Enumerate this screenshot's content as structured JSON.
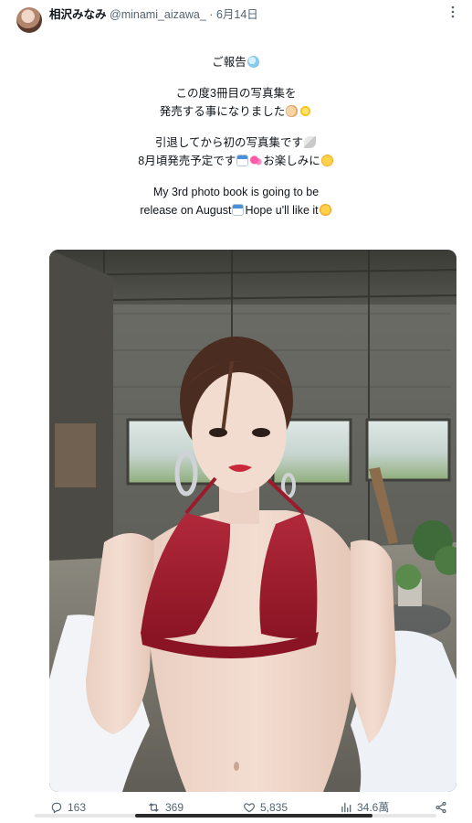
{
  "tweet": {
    "author_name": "相沢みなみ",
    "handle": "@minami_aizawa_",
    "separator": "·",
    "date": "6月14日",
    "lines": {
      "l1": "ご報告",
      "l2": "この度3冊目の写真集を",
      "l3": "発売する事になりました",
      "l4": "引退してから初の写真集です",
      "l5a": "8月頃発売予定です",
      "l5b": "お楽しみに",
      "l6": "My 3rd photo book is going to be",
      "l7a": "release on August",
      "l7b": "Hope u'll like it"
    },
    "emoji_icons": [
      "bubbles-emoji",
      "clapping-hands-emoji",
      "sparkle-emoji",
      "wing-emoji",
      "calendar-emoji",
      "hearts-emoji",
      "smiling-hearts-emoji",
      "party-face-emoji"
    ]
  },
  "actions": {
    "replies": "163",
    "retweets": "369",
    "likes": "5,835",
    "views": "34.6萬"
  },
  "icons": {
    "more": "more-options-icon",
    "reply": "reply-icon",
    "retweet": "retweet-icon",
    "like": "heart-icon",
    "views": "views-bar-chart-icon",
    "share": "share-icon"
  },
  "colors": {
    "text": "#0f1419",
    "muted": "#536471",
    "bikini": "#9b1b2c"
  }
}
